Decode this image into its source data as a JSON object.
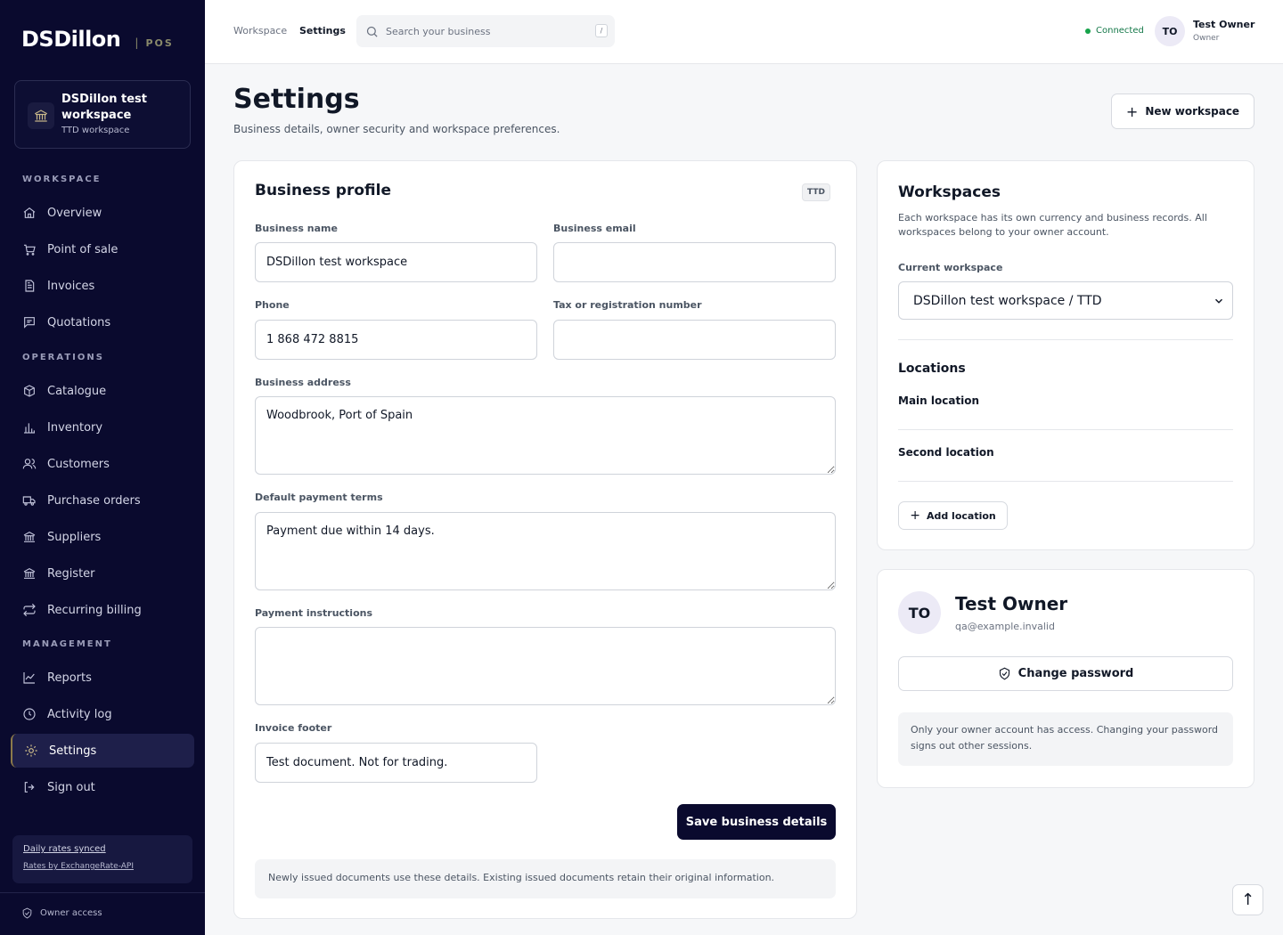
{
  "brand": {
    "name": "DSDillon",
    "separator": "|",
    "product": "POS"
  },
  "workspace_card": {
    "name": "DSDillon test workspace",
    "subtitle": "TTD workspace",
    "icon": "bank-icon"
  },
  "sidebar": {
    "sections": [
      {
        "label": "WORKSPACE"
      },
      {
        "label": "OPERATIONS"
      },
      {
        "label": "MANAGEMENT"
      }
    ],
    "items": [
      {
        "label": "Overview",
        "icon": "home-icon"
      },
      {
        "label": "Point of sale",
        "icon": "cart-icon"
      },
      {
        "label": "Invoices",
        "icon": "document-icon"
      },
      {
        "label": "Quotations",
        "icon": "message-icon"
      },
      {
        "label": "Catalogue",
        "icon": "box-icon"
      },
      {
        "label": "Inventory",
        "icon": "bar-chart-icon"
      },
      {
        "label": "Customers",
        "icon": "users-icon"
      },
      {
        "label": "Purchase orders",
        "icon": "truck-icon"
      },
      {
        "label": "Suppliers",
        "icon": "bank-icon"
      },
      {
        "label": "Register",
        "icon": "bank-icon"
      },
      {
        "label": "Recurring billing",
        "icon": "repeat-icon"
      },
      {
        "label": "Reports",
        "icon": "line-chart-icon"
      },
      {
        "label": "Activity log",
        "icon": "clock-icon"
      },
      {
        "label": "Settings",
        "icon": "gear-icon"
      },
      {
        "label": "Sign out",
        "icon": "sign-out-icon"
      }
    ],
    "active_item": "Settings",
    "rates_synced": "Daily rates synced",
    "rates_source": "Rates by ExchangeRate-API",
    "owner_access": "Owner access"
  },
  "topbar": {
    "breadcrumb": [
      "Workspace",
      "Settings"
    ],
    "search_placeholder": "Search your business",
    "search_shortcut": "/",
    "status": "Connected",
    "user_initials": "TO",
    "user_name": "Test Owner",
    "user_role": "Owner"
  },
  "page": {
    "title": "Settings",
    "subtitle": "Business details, owner security and workspace preferences.",
    "new_workspace_label": "New workspace"
  },
  "business_profile": {
    "title": "Business profile",
    "currency_tag": "TTD",
    "fields": {
      "business_name": {
        "label": "Business name",
        "value": "DSDillon test workspace"
      },
      "business_email": {
        "label": "Business email",
        "value": ""
      },
      "phone": {
        "label": "Phone",
        "value": "1 868 472 8815"
      },
      "tax_number": {
        "label": "Tax or registration number",
        "value": ""
      },
      "business_address": {
        "label": "Business address",
        "value": "Woodbrook, Port of Spain"
      },
      "payment_terms": {
        "label": "Default payment terms",
        "value": "Payment due within 14 days."
      },
      "payment_instructions": {
        "label": "Payment instructions",
        "value": ""
      },
      "invoice_footer": {
        "label": "Invoice footer",
        "value": "Test document. Not for trading."
      }
    },
    "save_label": "Save business details",
    "note": "Newly issued documents use these details. Existing issued documents retain their original information."
  },
  "workspaces": {
    "title": "Workspaces",
    "description": "Each workspace has its own currency and business records. All workspaces belong to your owner account.",
    "current_label": "Current workspace",
    "current_value": "DSDillon test workspace / TTD",
    "locations_title": "Locations",
    "locations": [
      "Main location",
      "Second location"
    ],
    "add_location_label": "Add location"
  },
  "owner": {
    "initials": "TO",
    "name": "Test Owner",
    "email": "qa@example.invalid",
    "change_password_label": "Change password",
    "note": "Only your owner account has access. Changing your password signs out other sessions."
  },
  "scroll_top": "↑"
}
